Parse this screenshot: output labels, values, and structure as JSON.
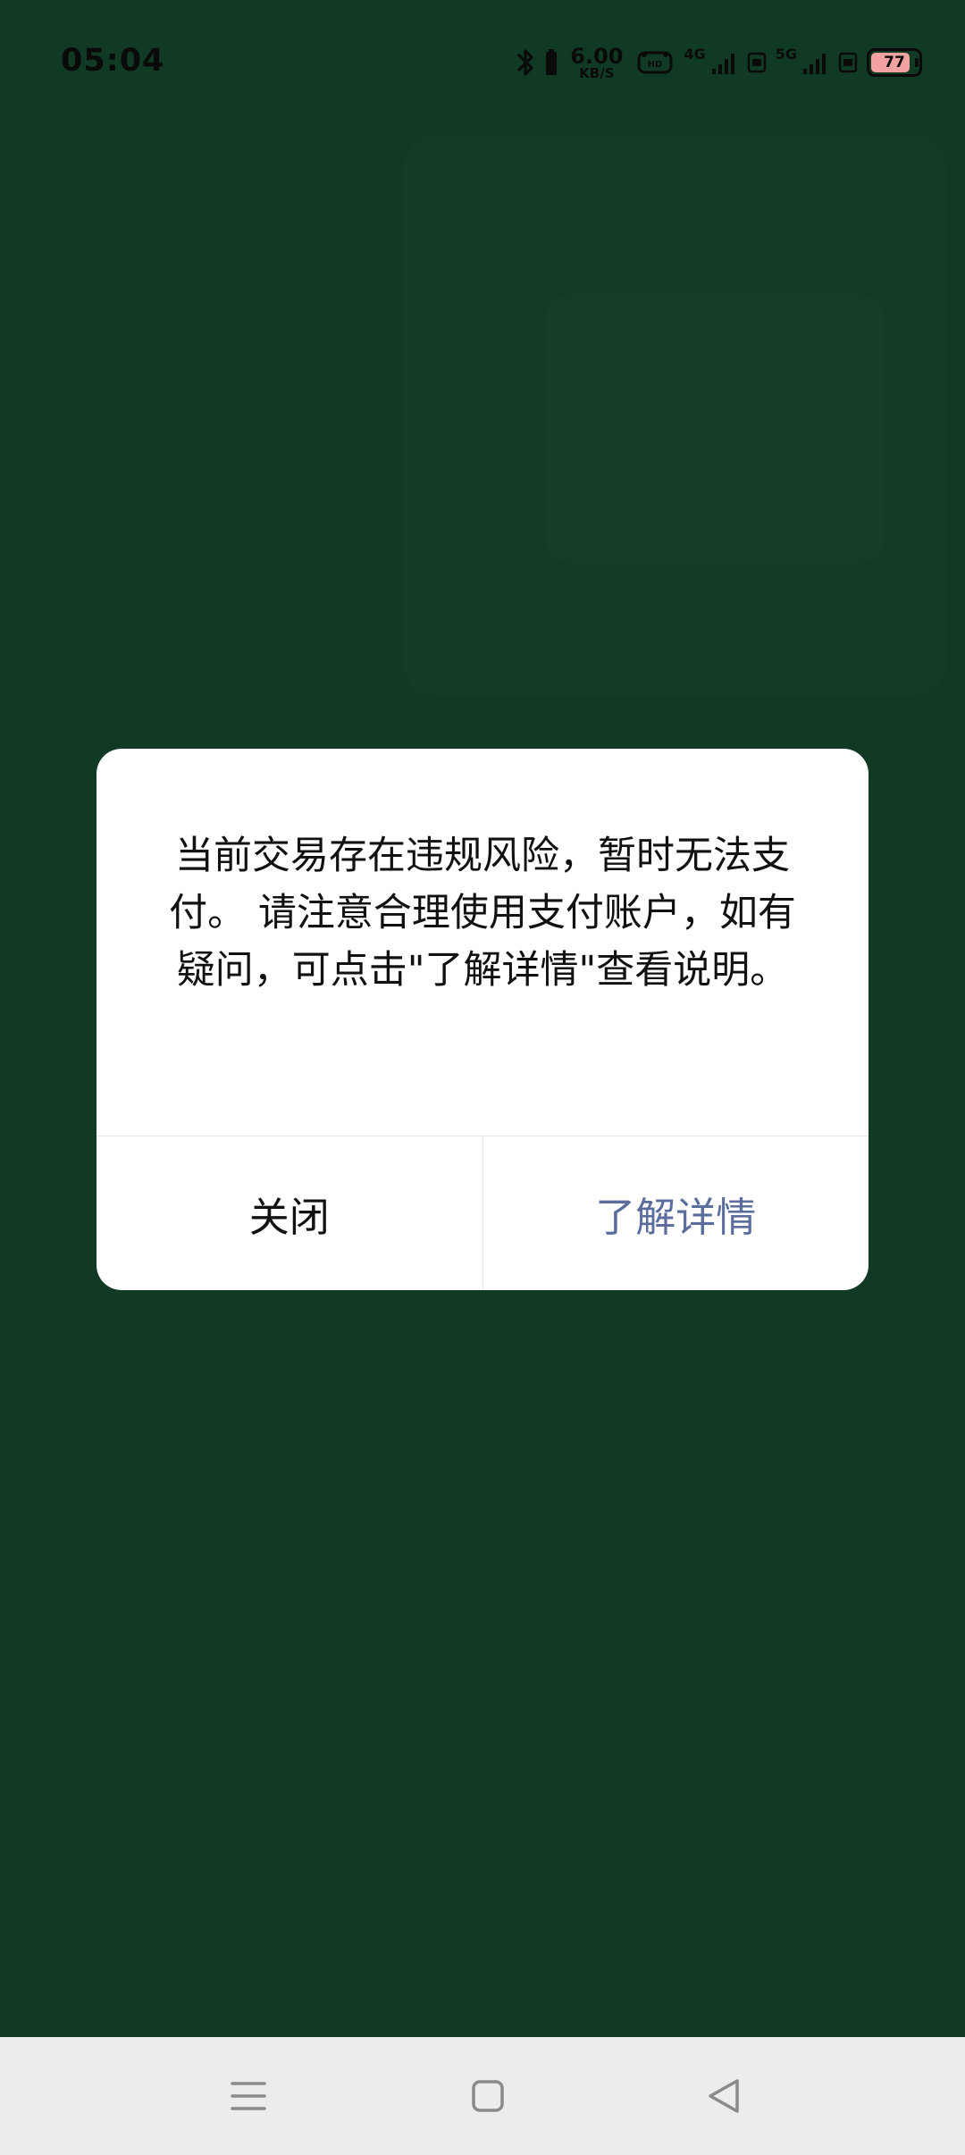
{
  "status_bar": {
    "time": "05:04",
    "net_speed_value": "6.00",
    "net_speed_unit": "KB/S",
    "sim1_network": "4G",
    "sim2_network": "5G",
    "battery_level": "77",
    "icons": [
      "bluetooth-icon",
      "hd-icon",
      "signal-icon",
      "battery-icon"
    ]
  },
  "dialog": {
    "message": "当前交易存在违规风险，暂时无法支付。 请注意合理使用支付账户，如有疑问，可点击\"了解详情\"查看说明。",
    "close_label": "关闭",
    "details_label": "了解详情",
    "details_color": "#5a6d9c"
  },
  "nav_bar": {
    "icons": [
      "menu-icon",
      "home-icon",
      "back-icon"
    ]
  },
  "colors": {
    "background": "#113a25",
    "dialog_bg": "#ffffff",
    "nav_bg": "#ececec"
  }
}
